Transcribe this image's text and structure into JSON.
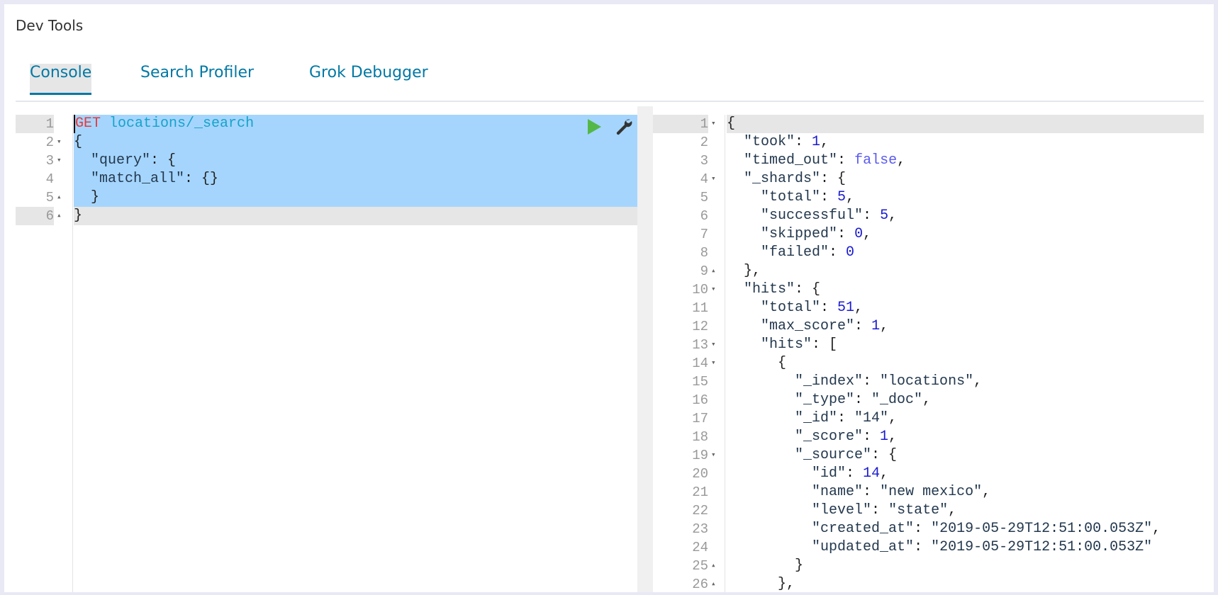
{
  "app": {
    "title": "Dev Tools"
  },
  "tabs": [
    {
      "label": "Console",
      "active": true
    },
    {
      "label": "Search Profiler",
      "active": false
    },
    {
      "label": "Grok Debugger",
      "active": false
    }
  ],
  "colors": {
    "accent": "#0079a5",
    "selection": "#a5d5fd",
    "run": "#54b848"
  },
  "request_editor": {
    "actions": {
      "run_icon": "play-icon",
      "settings_icon": "wrench-icon"
    },
    "lines": [
      {
        "n": "1",
        "fold": "",
        "state": "sel-first",
        "tokens": [
          [
            "method",
            "GET"
          ],
          [
            "p",
            " "
          ],
          [
            "url",
            "locations/_search"
          ]
        ]
      },
      {
        "n": "2",
        "fold": "▾",
        "state": "sel",
        "tokens": [
          [
            "p",
            "{"
          ]
        ]
      },
      {
        "n": "3",
        "fold": "▾",
        "state": "sel",
        "tokens": [
          [
            "p",
            "  "
          ],
          [
            "key",
            "\"query\""
          ],
          [
            "p",
            ": {"
          ]
        ]
      },
      {
        "n": "4",
        "fold": "",
        "state": "sel",
        "indent": 1,
        "tokens": [
          [
            "p",
            "  "
          ],
          [
            "key",
            "\"match_all\""
          ],
          [
            "p",
            ": {}"
          ]
        ]
      },
      {
        "n": "5",
        "fold": "▴",
        "state": "sel",
        "tokens": [
          [
            "p",
            "  }"
          ]
        ]
      },
      {
        "n": "6",
        "fold": "▴",
        "state": "active",
        "tokens": [
          [
            "p",
            "}"
          ]
        ]
      }
    ]
  },
  "response_viewer": {
    "lines": [
      {
        "n": "1",
        "fold": "▾",
        "state": "active",
        "tokens": [
          [
            "p",
            "{"
          ]
        ]
      },
      {
        "n": "2",
        "fold": "",
        "tokens": [
          [
            "p",
            "  "
          ],
          [
            "key",
            "\"took\""
          ],
          [
            "p",
            ": "
          ],
          [
            "num",
            "1"
          ],
          [
            "p",
            ","
          ]
        ]
      },
      {
        "n": "3",
        "fold": "",
        "tokens": [
          [
            "p",
            "  "
          ],
          [
            "key",
            "\"timed_out\""
          ],
          [
            "p",
            ": "
          ],
          [
            "bool",
            "false"
          ],
          [
            "p",
            ","
          ]
        ]
      },
      {
        "n": "4",
        "fold": "▾",
        "tokens": [
          [
            "p",
            "  "
          ],
          [
            "key",
            "\"_shards\""
          ],
          [
            "p",
            ": {"
          ]
        ]
      },
      {
        "n": "5",
        "fold": "",
        "indent": 1,
        "tokens": [
          [
            "p",
            "    "
          ],
          [
            "key",
            "\"total\""
          ],
          [
            "p",
            ": "
          ],
          [
            "num",
            "5"
          ],
          [
            "p",
            ","
          ]
        ]
      },
      {
        "n": "6",
        "fold": "",
        "indent": 1,
        "tokens": [
          [
            "p",
            "    "
          ],
          [
            "key",
            "\"successful\""
          ],
          [
            "p",
            ": "
          ],
          [
            "num",
            "5"
          ],
          [
            "p",
            ","
          ]
        ]
      },
      {
        "n": "7",
        "fold": "",
        "indent": 1,
        "tokens": [
          [
            "p",
            "    "
          ],
          [
            "key",
            "\"skipped\""
          ],
          [
            "p",
            ": "
          ],
          [
            "num",
            "0"
          ],
          [
            "p",
            ","
          ]
        ]
      },
      {
        "n": "8",
        "fold": "",
        "indent": 1,
        "tokens": [
          [
            "p",
            "    "
          ],
          [
            "key",
            "\"failed\""
          ],
          [
            "p",
            ": "
          ],
          [
            "num",
            "0"
          ]
        ]
      },
      {
        "n": "9",
        "fold": "▴",
        "tokens": [
          [
            "p",
            "  },"
          ]
        ]
      },
      {
        "n": "10",
        "fold": "▾",
        "tokens": [
          [
            "p",
            "  "
          ],
          [
            "key",
            "\"hits\""
          ],
          [
            "p",
            ": {"
          ]
        ]
      },
      {
        "n": "11",
        "fold": "",
        "indent": 1,
        "tokens": [
          [
            "p",
            "    "
          ],
          [
            "key",
            "\"total\""
          ],
          [
            "p",
            ": "
          ],
          [
            "num",
            "51"
          ],
          [
            "p",
            ","
          ]
        ]
      },
      {
        "n": "12",
        "fold": "",
        "indent": 1,
        "tokens": [
          [
            "p",
            "    "
          ],
          [
            "key",
            "\"max_score\""
          ],
          [
            "p",
            ": "
          ],
          [
            "num",
            "1"
          ],
          [
            "p",
            ","
          ]
        ]
      },
      {
        "n": "13",
        "fold": "▾",
        "indent": 1,
        "tokens": [
          [
            "p",
            "    "
          ],
          [
            "key",
            "\"hits\""
          ],
          [
            "p",
            ": ["
          ]
        ]
      },
      {
        "n": "14",
        "fold": "▾",
        "indent": 2,
        "tokens": [
          [
            "p",
            "      {"
          ]
        ]
      },
      {
        "n": "15",
        "fold": "",
        "indent": 3,
        "tokens": [
          [
            "p",
            "        "
          ],
          [
            "key",
            "\"_index\""
          ],
          [
            "p",
            ": "
          ],
          [
            "str",
            "\"locations\""
          ],
          [
            "p",
            ","
          ]
        ]
      },
      {
        "n": "16",
        "fold": "",
        "indent": 3,
        "tokens": [
          [
            "p",
            "        "
          ],
          [
            "key",
            "\"_type\""
          ],
          [
            "p",
            ": "
          ],
          [
            "str",
            "\"_doc\""
          ],
          [
            "p",
            ","
          ]
        ]
      },
      {
        "n": "17",
        "fold": "",
        "indent": 3,
        "tokens": [
          [
            "p",
            "        "
          ],
          [
            "key",
            "\"_id\""
          ],
          [
            "p",
            ": "
          ],
          [
            "str",
            "\"14\""
          ],
          [
            "p",
            ","
          ]
        ]
      },
      {
        "n": "18",
        "fold": "",
        "indent": 3,
        "tokens": [
          [
            "p",
            "        "
          ],
          [
            "key",
            "\"_score\""
          ],
          [
            "p",
            ": "
          ],
          [
            "num",
            "1"
          ],
          [
            "p",
            ","
          ]
        ]
      },
      {
        "n": "19",
        "fold": "▾",
        "indent": 3,
        "tokens": [
          [
            "p",
            "        "
          ],
          [
            "key",
            "\"_source\""
          ],
          [
            "p",
            ": {"
          ]
        ]
      },
      {
        "n": "20",
        "fold": "",
        "indent": 4,
        "tokens": [
          [
            "p",
            "          "
          ],
          [
            "key",
            "\"id\""
          ],
          [
            "p",
            ": "
          ],
          [
            "num",
            "14"
          ],
          [
            "p",
            ","
          ]
        ]
      },
      {
        "n": "21",
        "fold": "",
        "indent": 4,
        "tokens": [
          [
            "p",
            "          "
          ],
          [
            "key",
            "\"name\""
          ],
          [
            "p",
            ": "
          ],
          [
            "str",
            "\"new mexico\""
          ],
          [
            "p",
            ","
          ]
        ]
      },
      {
        "n": "22",
        "fold": "",
        "indent": 4,
        "tokens": [
          [
            "p",
            "          "
          ],
          [
            "key",
            "\"level\""
          ],
          [
            "p",
            ": "
          ],
          [
            "str",
            "\"state\""
          ],
          [
            "p",
            ","
          ]
        ]
      },
      {
        "n": "23",
        "fold": "",
        "indent": 4,
        "tokens": [
          [
            "p",
            "          "
          ],
          [
            "key",
            "\"created_at\""
          ],
          [
            "p",
            ": "
          ],
          [
            "str",
            "\"2019-05-29T12:51:00.053Z\""
          ],
          [
            "p",
            ","
          ]
        ]
      },
      {
        "n": "24",
        "fold": "",
        "indent": 4,
        "tokens": [
          [
            "p",
            "          "
          ],
          [
            "key",
            "\"updated_at\""
          ],
          [
            "p",
            ": "
          ],
          [
            "str",
            "\"2019-05-29T12:51:00.053Z\""
          ]
        ]
      },
      {
        "n": "25",
        "fold": "▴",
        "indent": 3,
        "tokens": [
          [
            "p",
            "        }"
          ]
        ]
      },
      {
        "n": "26",
        "fold": "▴",
        "indent": 2,
        "tokens": [
          [
            "p",
            "      },"
          ]
        ]
      }
    ]
  }
}
